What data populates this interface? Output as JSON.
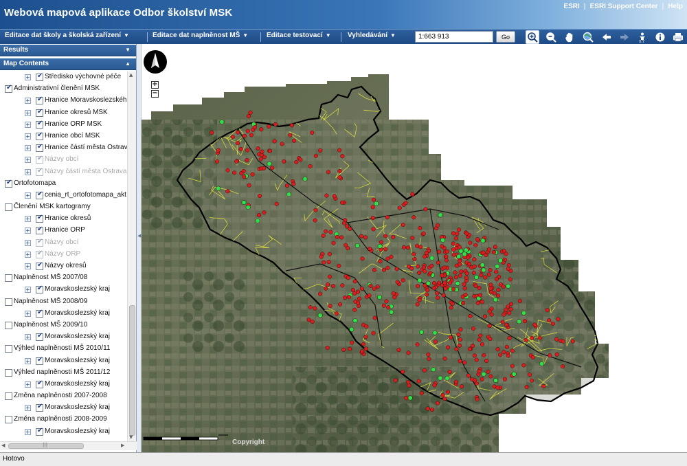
{
  "header": {
    "title": "Webová mapová aplikace Odbor školství MSK",
    "links": [
      "ESRI",
      "ESRI Support Center",
      "Help"
    ]
  },
  "menu": {
    "items": [
      "Editace dat školy a školská zařízení",
      "Editace dat naplněnost MŠ",
      "Editace testovací",
      "Vyhledávání"
    ],
    "scale_value": "1:663 913",
    "go_label": "Go"
  },
  "tools": [
    "zoom-in-icon",
    "zoom-out-icon",
    "pan-hand-icon",
    "full-extent-icon",
    "back-arrow-icon",
    "forward-arrow-icon",
    "identify-xy-icon",
    "info-icon",
    "print-icon"
  ],
  "panels": {
    "results": "Results",
    "map_contents": "Map Contents"
  },
  "tree": [
    {
      "label": "Středisko výchovné péče",
      "level": 2,
      "checked": true,
      "dim": false
    },
    {
      "label": "Administrativní členění MSK",
      "level": 1,
      "checked": true,
      "dim": false
    },
    {
      "label": "Hranice Moravskoslezského",
      "level": 2,
      "checked": true,
      "dim": false
    },
    {
      "label": "Hranice okresů MSK",
      "level": 2,
      "checked": true,
      "dim": false
    },
    {
      "label": "Hranice ORP MSK",
      "level": 2,
      "checked": true,
      "dim": false
    },
    {
      "label": "Hranice obcí MSK",
      "level": 2,
      "checked": true,
      "dim": false
    },
    {
      "label": "Hranice částí města Ostrav",
      "level": 2,
      "checked": true,
      "dim": false
    },
    {
      "label": "Názvy obcí",
      "level": 2,
      "checked": true,
      "dim": true
    },
    {
      "label": "Názvy částí města Ostrava",
      "level": 2,
      "checked": true,
      "dim": true
    },
    {
      "label": "Ortofotomapa",
      "level": 1,
      "checked": true,
      "dim": false
    },
    {
      "label": "cenia_rt_ortofotomapa_akt",
      "level": 2,
      "checked": true,
      "dim": false
    },
    {
      "label": "Členění MSK kartogramy",
      "level": 1,
      "checked": false,
      "dim": false
    },
    {
      "label": "Hranice okresů",
      "level": 2,
      "checked": true,
      "dim": false
    },
    {
      "label": "Hranice ORP",
      "level": 2,
      "checked": true,
      "dim": false
    },
    {
      "label": "Názvy obcí",
      "level": 2,
      "checked": true,
      "dim": true
    },
    {
      "label": "Názvy ORP",
      "level": 2,
      "checked": true,
      "dim": true
    },
    {
      "label": "Názvy okresů",
      "level": 2,
      "checked": true,
      "dim": false
    },
    {
      "label": "Naplněnost MŠ 2007/08",
      "level": 1,
      "checked": false,
      "dim": false
    },
    {
      "label": "Moravskoslezský kraj",
      "level": 2,
      "checked": true,
      "dim": false
    },
    {
      "label": "Naplněnost MŠ 2008/09",
      "level": 1,
      "checked": false,
      "dim": false
    },
    {
      "label": "Moravskoslezský kraj",
      "level": 2,
      "checked": true,
      "dim": false
    },
    {
      "label": "Naplněnost MŠ 2009/10",
      "level": 1,
      "checked": false,
      "dim": false
    },
    {
      "label": "Moravskoslezský kraj",
      "level": 2,
      "checked": true,
      "dim": false
    },
    {
      "label": "Výhled naplněnosti MŠ 2010/11",
      "level": 1,
      "checked": false,
      "dim": false
    },
    {
      "label": "Moravskoslezský kraj",
      "level": 2,
      "checked": true,
      "dim": false
    },
    {
      "label": "Výhled naplněnosti MŠ 2011/12",
      "level": 1,
      "checked": false,
      "dim": false
    },
    {
      "label": "Moravskoslezský kraj",
      "level": 2,
      "checked": true,
      "dim": false
    },
    {
      "label": "Změna naplněnosti 2007-2008",
      "level": 1,
      "checked": false,
      "dim": false
    },
    {
      "label": "Moravskoslezský kraj",
      "level": 2,
      "checked": true,
      "dim": false
    },
    {
      "label": "Změna naplněnosti 2008-2009",
      "level": 1,
      "checked": false,
      "dim": false
    },
    {
      "label": "Moravskoslezský kraj",
      "level": 2,
      "checked": true,
      "dim": false
    }
  ],
  "map": {
    "copyright": "Copyright",
    "zoom_in": "+",
    "zoom_out": "−",
    "colors": {
      "imagery": "#4e5a44",
      "region_outline": "#000000",
      "municipal_boundaries": "#e8e83a",
      "school_points_red": "#d81e1e",
      "school_points_green": "#2ee04a"
    }
  },
  "status": {
    "text": "Hotovo"
  }
}
